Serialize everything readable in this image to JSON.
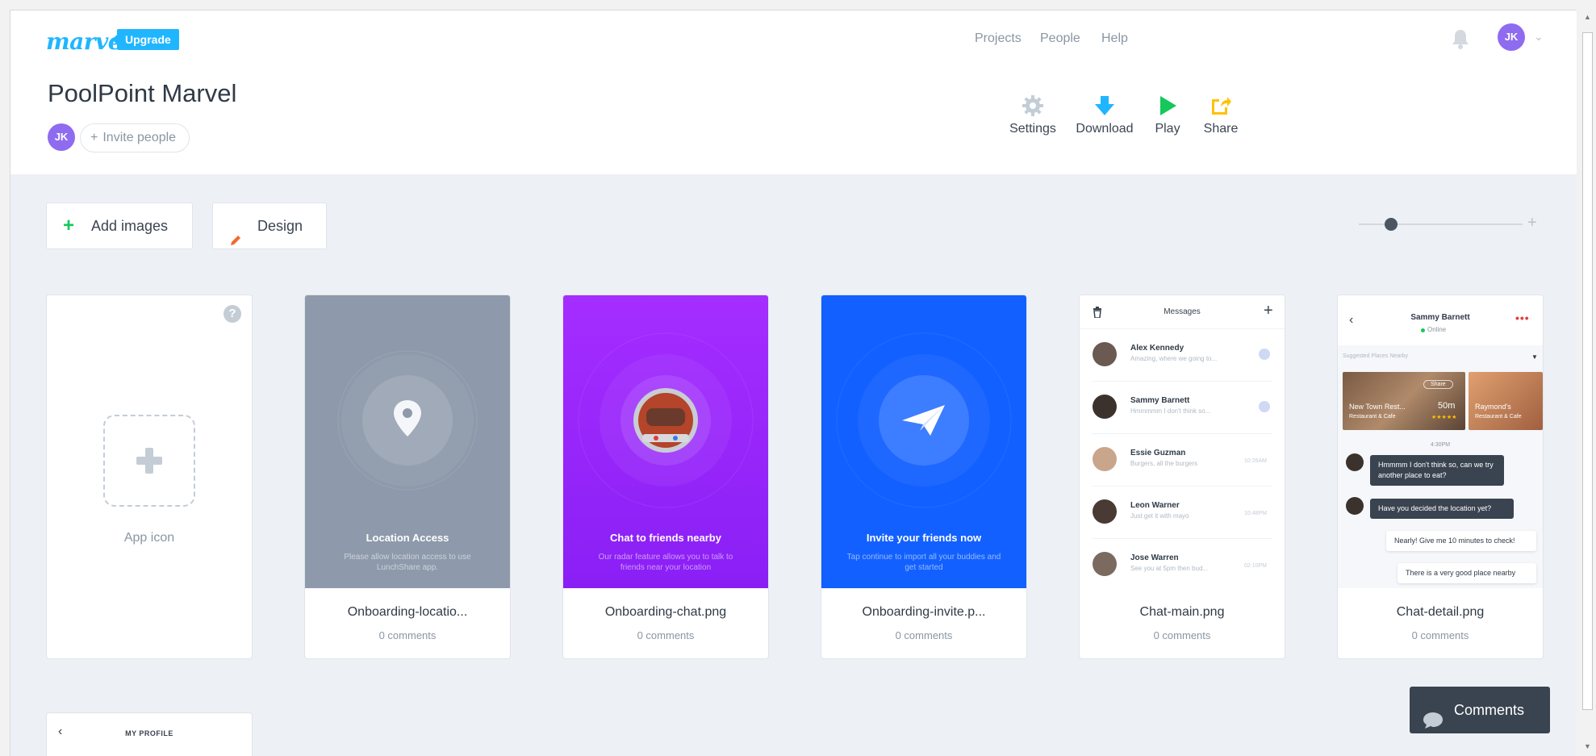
{
  "header": {
    "logo": "marvel",
    "upgrade_label": "Upgrade",
    "nav": [
      {
        "label": "Projects"
      },
      {
        "label": "People"
      },
      {
        "label": "Help"
      }
    ],
    "user_initials": "JK"
  },
  "project": {
    "title": "PoolPoint Marvel",
    "member_initials": "JK",
    "invite_label": "Invite people"
  },
  "tools": [
    {
      "label": "Settings",
      "icon": "gear-icon"
    },
    {
      "label": "Download",
      "icon": "download-icon"
    },
    {
      "label": "Play",
      "icon": "play-icon"
    },
    {
      "label": "Share",
      "icon": "share-icon"
    }
  ],
  "toolbar": {
    "add_images_label": "Add images",
    "design_label": "Design"
  },
  "app_icon_card": {
    "label": "App icon",
    "help": "?"
  },
  "cards": [
    {
      "name": "Onboarding-locatio...",
      "comments": "0 comments",
      "screen_title": "Location Access",
      "screen_desc": "Please allow location access to use LunchShare app."
    },
    {
      "name": "Onboarding-chat.png",
      "comments": "0 comments",
      "screen_title": "Chat to friends nearby",
      "screen_desc": "Our radar feature allows you to talk to friends near your location"
    },
    {
      "name": "Onboarding-invite.p...",
      "comments": "0 comments",
      "screen_title": "Invite your friends now",
      "screen_desc": "Tap continue to import all your buddies and get started"
    },
    {
      "name": "Chat-main.png",
      "comments": "0 comments",
      "screen_title": "Messages",
      "rows": [
        {
          "name": "Alex Kennedy",
          "preview": "Amazing, where we going to..."
        },
        {
          "name": "Sammy Barnett",
          "preview": "Hmmmmm I don't think so..."
        },
        {
          "name": "Essie Guzman",
          "preview": "Burgers, all the burgers",
          "time": "10:26AM"
        },
        {
          "name": "Leon Warner",
          "preview": "Just get it with mayo",
          "time": "10:48PM"
        },
        {
          "name": "Jose Warren",
          "preview": "See you at 5pm then bud...",
          "time": "02:10PM"
        }
      ]
    },
    {
      "name": "Chat-detail.png",
      "comments": "0 comments",
      "contact": "Sammy Barnett",
      "status": "Online",
      "suggested": "Suggested Places Nearby",
      "place1": "New Town Rest...",
      "place1_sub": "Restaurant & Cafe",
      "place1_dist": "50m",
      "place1_share": "Share",
      "place2": "Raymond's",
      "place2_sub": "Restaurant & Cafe",
      "time": "4:30PM",
      "messages": [
        "Hmmmm I don't think so, can we try another place to eat?",
        "Have you decided the location yet?",
        "Nearly! Give me 10 minutes to check!",
        "There is a very good place nearby"
      ]
    }
  ],
  "profile_card": {
    "title": "MY PROFILE"
  },
  "comments_button": {
    "label": "Comments"
  },
  "colors": {
    "brand": "#1fb6ff",
    "avatar": "#8f6bf0",
    "location_bg": "#8e9aab",
    "chat_bg": "#9b30ff",
    "invite_bg": "#1260ff",
    "download": "#1fb6ff",
    "play": "#14c85a",
    "share": "#ffc107",
    "add_icon": "#14c85a",
    "design_icon": "#f26a2e"
  }
}
